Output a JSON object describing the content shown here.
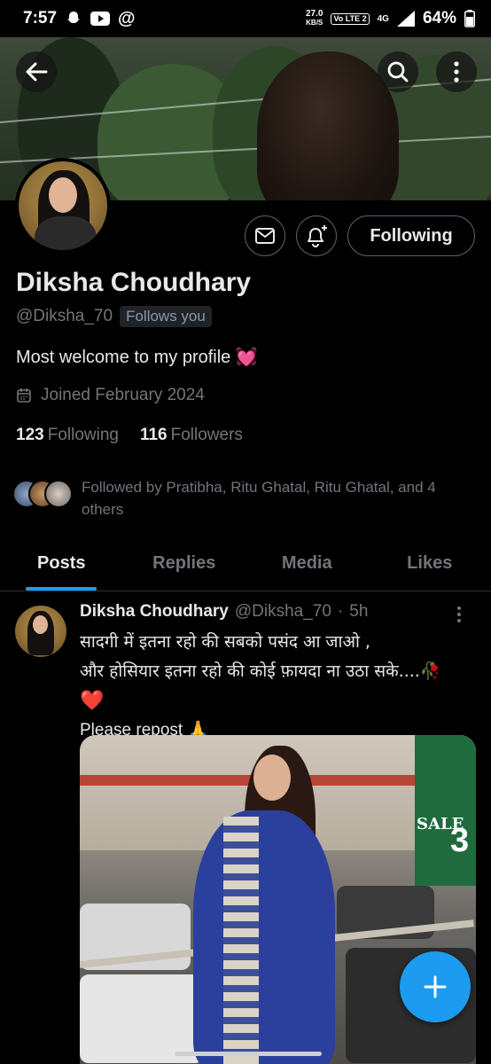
{
  "status_bar": {
    "time": "7:57",
    "net_speed_value": "27.0",
    "net_speed_unit": "KB/S",
    "volte": "Vo LTE 2",
    "network": "4G",
    "battery": "64%"
  },
  "profile": {
    "name": "Diksha Choudhary",
    "handle": "@Diksha_70",
    "follows_you": "Follows you",
    "bio": "Most welcome to my profile",
    "bio_emoji": "💓",
    "joined": "Joined February 2024",
    "following_count": "123",
    "following_label": "Following",
    "followers_count": "116",
    "followers_label": "Followers",
    "followed_by": "Followed by Pratibha, Ritu Ghatal, Ritu Ghatal, and 4 others",
    "follow_button": "Following"
  },
  "tabs": [
    {
      "label": "Posts",
      "active": true
    },
    {
      "label": "Replies",
      "active": false
    },
    {
      "label": "Media",
      "active": false
    },
    {
      "label": "Likes",
      "active": false
    }
  ],
  "post": {
    "author": "Diksha Choudhary",
    "handle": "@Diksha_70",
    "separator": "·",
    "time": "5h",
    "line1": "सादगी में इतना रहो की सबको पसंद आ जाओ ,",
    "line2": "और होसियार इतना रहो की कोई फ़ायदा ना उठा सके....🥀",
    "line3": "❤️",
    "line4": "Please repost 🙏",
    "image_sign_sale": "SALE",
    "image_sign_number": "3"
  },
  "colors": {
    "accent": "#1d9bf0",
    "text_primary": "#e7e9ea",
    "text_secondary": "#71767b",
    "border": "#536471"
  },
  "icons": {
    "back": "arrow-left-icon",
    "search": "search-icon",
    "more": "more-vertical-icon",
    "message": "envelope-icon",
    "notify": "bell-plus-icon",
    "calendar": "calendar-icon",
    "compose": "plus-icon"
  }
}
